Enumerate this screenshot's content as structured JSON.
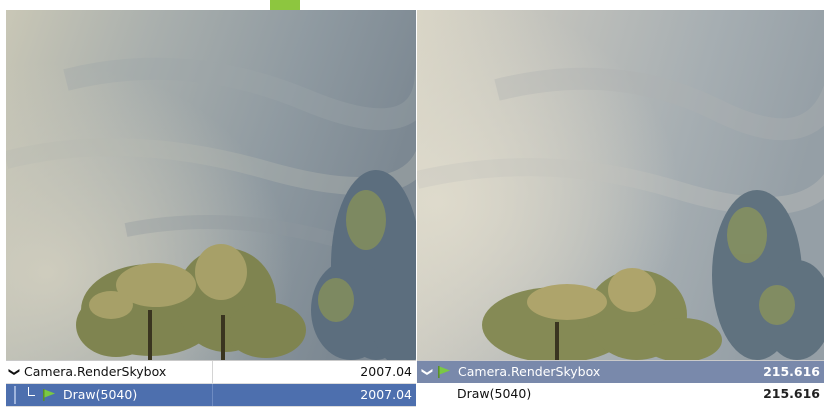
{
  "left_panel": {
    "rows": [
      {
        "label": "Camera.RenderSkybox",
        "value": "2007.04",
        "expand_icon": "chevron-down-icon"
      },
      {
        "label": "Draw(5040)",
        "value": "2007.04",
        "icon": "flag-icon"
      }
    ]
  },
  "right_panel": {
    "rows": [
      {
        "label": "Camera.RenderSkybox",
        "value": "215.616",
        "expand_icon": "chevron-down-icon",
        "icon": "flag-icon"
      },
      {
        "label": "Draw(5040)",
        "value": "215.616"
      }
    ]
  },
  "colors": {
    "selection_left": "#4d6fae",
    "selection_right": "#7989ab",
    "flag": "#7ac943",
    "top_accent": "#8dc63f"
  }
}
